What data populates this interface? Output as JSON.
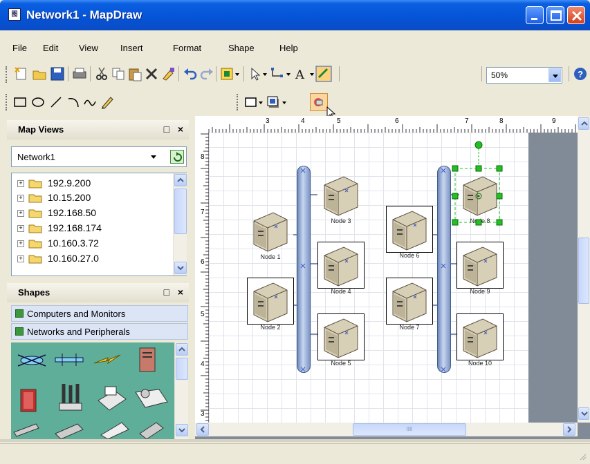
{
  "window": {
    "title": "Network1 - MapDraw",
    "app_icon_text": "图"
  },
  "menu": [
    "File",
    "Edit",
    "View",
    "Insert",
    "Format",
    "Shape",
    "Help"
  ],
  "toolbar": {
    "zoom": "50%"
  },
  "map_views": {
    "title": "Map Views",
    "selected_view": "Network1",
    "tree": [
      "192.9.200",
      "10.15.200",
      "192.168.50",
      "192.168.174",
      "10.160.3.72",
      "10.160.27.0"
    ]
  },
  "shapes": {
    "title": "Shapes",
    "stencils": [
      "Computers and Monitors",
      "Networks and Peripherals"
    ]
  },
  "panel_controls": {
    "restore": "□",
    "close": "×"
  },
  "ruler": {
    "top_marks": [
      "3",
      "4",
      "5",
      "6",
      "7",
      "8",
      "9"
    ],
    "left_marks": [
      "8",
      "7",
      "6",
      "5",
      "4",
      "3"
    ]
  },
  "nodes": [
    "Node 1",
    "Node 2",
    "Node 3",
    "Node 4",
    "Node 5",
    "Node 6",
    "Node 7",
    "Node 8",
    "Node 9",
    "Node 10"
  ],
  "scroll": {
    "hthumb_grip": "IIII"
  },
  "colors": {
    "title_bar": "#0653d6",
    "stencil_bg": "#5fae99",
    "selection_handle": "#22c022",
    "bus": "#7d95c4"
  },
  "icons": [
    "new-icon",
    "open-icon",
    "save-icon",
    "print-icon",
    "cut-icon",
    "copy-icon",
    "paste-icon",
    "delete-icon",
    "format-painter-icon",
    "undo-icon",
    "redo-icon",
    "map-icon",
    "pointer-icon",
    "connector-icon",
    "text-icon",
    "fill-icon",
    "help-icon"
  ]
}
